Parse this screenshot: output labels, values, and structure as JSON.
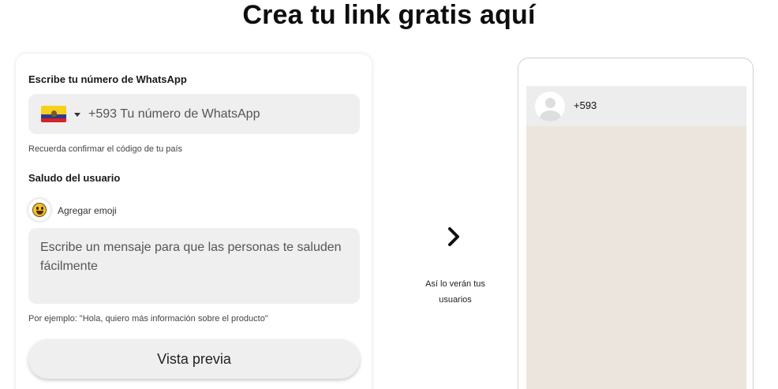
{
  "page": {
    "title": "Crea tu link gratis aquí"
  },
  "form": {
    "whatsapp_label": "Escribe tu número de WhatsApp",
    "country_code": "+593",
    "phone_placeholder": "+593 Tu número de WhatsApp",
    "country_help": "Recuerda confirmar el código de tu país",
    "greeting_label": "Saludo del usuario",
    "emoji_label": "Agregar emoji",
    "message_placeholder": "Escribe un mensaje para que las personas te saluden fácilmente",
    "example_text": "Por ejemplo: \"Hola, quiero más información sobre el producto\"",
    "preview_button": "Vista previa"
  },
  "preview": {
    "caption_line1": "Así lo verán tus",
    "caption_line2": "usuarios",
    "contact_number": "+593"
  },
  "icons": {
    "flag": "ecuador-flag-icon",
    "dropdown": "caret-down-icon",
    "emoji": "smiley-emoji-icon",
    "arrow": "chevron-right-icon",
    "avatar": "default-avatar-icon"
  },
  "colors": {
    "field_bg": "#efefef",
    "chat_bg": "#ece5dd",
    "chat_header_bg": "#ededed"
  }
}
